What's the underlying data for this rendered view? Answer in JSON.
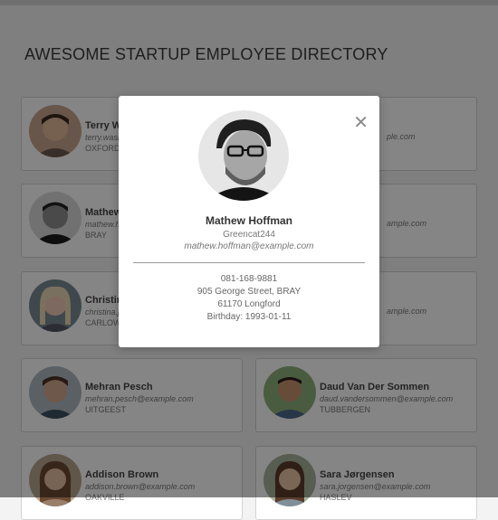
{
  "page": {
    "title": "AWESOME STARTUP EMPLOYEE DIRECTORY"
  },
  "employees": [
    {
      "name": "Terry Wa",
      "email": "terry.wasi",
      "city": "OXFORD",
      "right_email": "ple.com"
    },
    {
      "name": "Mathew",
      "email": "mathew.h",
      "city": "BRAY",
      "right_email": "ample.com"
    },
    {
      "name": "Christina",
      "email": "christina.j",
      "city": "CARLOW",
      "right_email": "ample.com"
    },
    {
      "name": "Mehran Pesch",
      "email": "mehran.pesch@example.com",
      "city": "UITGEEST"
    },
    {
      "name": "Daud Van Der Sommen",
      "email": "daud.vandersommen@example.com",
      "city": "TUBBERGEN"
    },
    {
      "name": "Addison Brown",
      "email": "addison.brown@example.com",
      "city": "OAKVILLE"
    },
    {
      "name": "Sara Jørgensen",
      "email": "sara.jorgensen@example.com",
      "city": "HASLEV"
    }
  ],
  "modal": {
    "name": "Mathew Hoffman",
    "username": "Greencat244",
    "email": "mathew.hoffman@example.com",
    "phone": "081-168-9881",
    "street": "905 George Street, BRAY",
    "postcode_city": "61170 Longford",
    "birthday": "Birthday: 1993-01-11",
    "close_symbol": "✕"
  },
  "colors": {
    "overlay": "rgba(0,0,0,0.48)",
    "card_border": "#d4d4d4",
    "text_dark": "#333333"
  }
}
